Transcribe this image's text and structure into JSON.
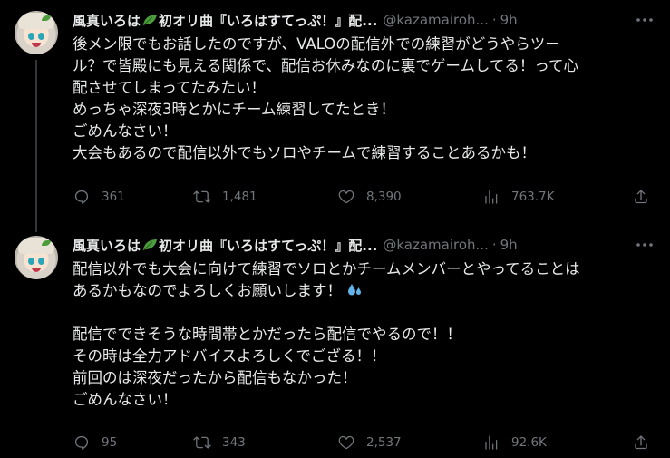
{
  "tweets": [
    {
      "display_name": "風真いろは",
      "display_name_suffix": "初オリ曲『いろはすてっぷ！』配...",
      "handle": "@kazamairoh...",
      "time": "9h",
      "text": "後メン限でもお話したのですが、VALOの配信外での練習がどうやらツー\nル？で皆殿にも見える関係で、配信お休みなのに裏でゲームしてる！って心\n配させてしまってたみたい！\nめっちゃ深夜3時とかにチーム練習してたとき！\nごめんなさい！\n大会もあるので配信以外でもソロやチームで練習することあるかも！",
      "text_emoji": "",
      "text_after": "",
      "replies": "361",
      "retweets": "1,481",
      "likes": "8,390",
      "views": "763.7K"
    },
    {
      "display_name": "風真いろは",
      "display_name_suffix": "初オリ曲『いろはすてっぷ！』配...",
      "handle": "@kazamairoh...",
      "time": "9h",
      "text": "配信以外でも大会に向けて練習でソロとかチームメンバーとやってることは\nあるかもなのでよろしくお願いします！",
      "text_emoji": "sweat-droplets-icon",
      "text_after": "\n\n配信でできそうな時間帯とかだったら配信でやるので！！\nその時は全力アドバイスよろしくでござる！！\n前回のは深夜だったから配信もなかった！\nごめんなさい！",
      "replies": "95",
      "retweets": "343",
      "likes": "2,537",
      "views": "92.6K"
    }
  ],
  "colors": {
    "background": "#000000",
    "text": "#e7e9ea",
    "muted": "#71767b",
    "thread_line": "#333639",
    "leaf_green": "#4c9c3d",
    "sweat_blue": "#5fb3e8"
  }
}
